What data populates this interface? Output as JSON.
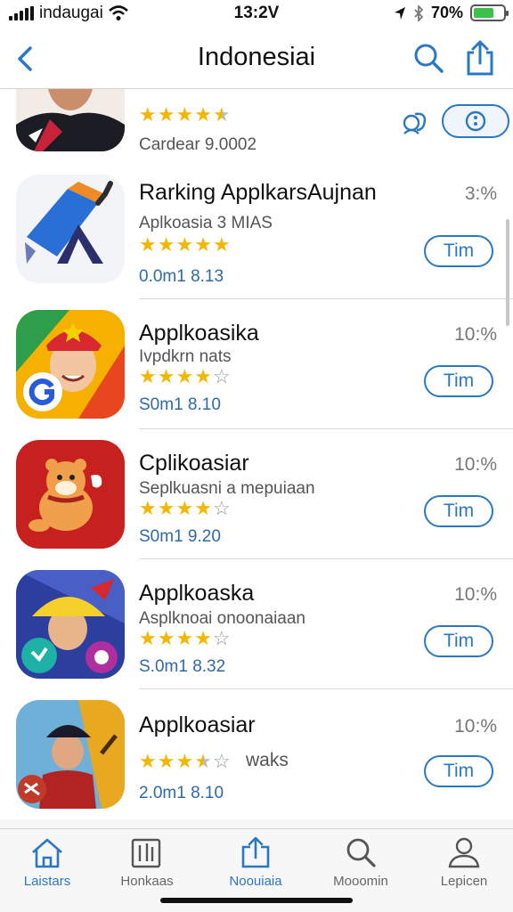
{
  "status_bar": {
    "carrier": "indaugai",
    "time": "13:2V",
    "battery": "70%",
    "battery_level": 0.7
  },
  "nav": {
    "title": "Indonesiai"
  },
  "apps": [
    {
      "name": "",
      "subtitle": "",
      "rating": 4.5,
      "meta": "Cardear 9.0002",
      "percent": "",
      "button": ""
    },
    {
      "name": "Rarking ApplkarsAujnan",
      "subtitle": "Aplkoasia 3 MIAS",
      "rating": 5,
      "meta": "0.0m1 8.13",
      "percent": "3:%",
      "button": "Tim"
    },
    {
      "name": "Applkoasika",
      "subtitle": "Ivpdkrn nats",
      "rating": 4,
      "meta": "S0m1 8.10",
      "percent": "10:%",
      "button": "Tim"
    },
    {
      "name": "Cplikoasiar",
      "subtitle": "Seplkuasni a mepuiaan",
      "rating": 4,
      "meta": "S0m1 9.20",
      "percent": "10:%",
      "button": "Tim"
    },
    {
      "name": "Applkoaska",
      "subtitle": "Asplknoai onoonaiaan",
      "rating": 4,
      "meta": "S.0m1 8.32",
      "percent": "10:%",
      "button": "Tim"
    },
    {
      "name": "Applkoasiar",
      "subtitle": "",
      "extra": "waks",
      "rating": 3.5,
      "meta": "2.0m1 8.10",
      "percent": "10:%",
      "button": "Tim"
    }
  ],
  "tabs": [
    {
      "label": "Laistars",
      "icon": "home-icon",
      "active": true
    },
    {
      "label": "Honkaas",
      "icon": "library-icon",
      "active": false
    },
    {
      "label": "Noouiaia",
      "icon": "share-icon",
      "active": true
    },
    {
      "label": "Mooomin",
      "icon": "search-icon",
      "active": false
    },
    {
      "label": "Lepicen",
      "icon": "person-icon",
      "active": false
    }
  ],
  "colors": {
    "accent": "#2a78c4",
    "star": "#f2b705",
    "battery": "#3cc24a"
  }
}
